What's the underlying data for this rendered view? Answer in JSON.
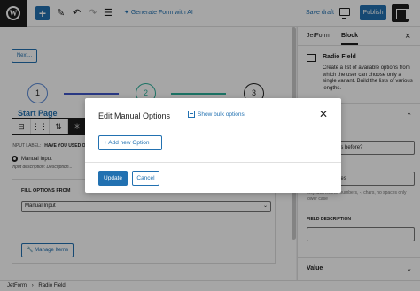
{
  "toolbar": {
    "logo_glyph": "W",
    "add_glyph": "+",
    "ai_label": "Generate Form with AI",
    "save_draft_label": "Save draft",
    "publish_label": "Publish",
    "icons": [
      "pencil-icon",
      "undo-icon",
      "redo-icon",
      "list-view-icon",
      "sparkle-icon",
      "preview-icon",
      "settings-sidebar-icon"
    ]
  },
  "canvas": {
    "prev_button_label": "Next...",
    "steps": [
      "1",
      "2",
      "3"
    ],
    "step_label": "Start Page",
    "input_label_caption": "INPUT LABEL:",
    "input_label_value": "HAVE YOU USED OU",
    "radio_option": "Manual Input",
    "input_description_caption": "Input description:",
    "input_description_value": "Description...",
    "fill_options_title": "FILL OPTIONS FROM",
    "fill_options_value": "Manual Input",
    "manage_items_label": "Manage Items"
  },
  "sidebar": {
    "tabs": [
      "JetForm",
      "Block"
    ],
    "active_tab": "Block",
    "block_title": "Radio Field",
    "block_description": "Create a list of available options from which the user can choose only a single variant. Build the lists of various lengths.",
    "label_value": "d our services before?",
    "name_caption": "E",
    "name_value": "d_our_services",
    "name_help": "only latin letters, numbers, -, chars, no spaces only lower case",
    "field_description_caption": "FIELD DESCRIPTION",
    "value_section": "Value"
  },
  "footer": {
    "breadcrumb": [
      "JetForm",
      "Radio Field"
    ]
  },
  "modal": {
    "title": "Edit Manual Options",
    "bulk_link": "Show bulk options",
    "add_option_label": "Add new Option",
    "update_label": "Update",
    "cancel_label": "Cancel"
  },
  "colors": {
    "accent": "#2271b1",
    "dark": "#1e1e1e",
    "overlay": "rgba(0,0,0,0.35)"
  }
}
